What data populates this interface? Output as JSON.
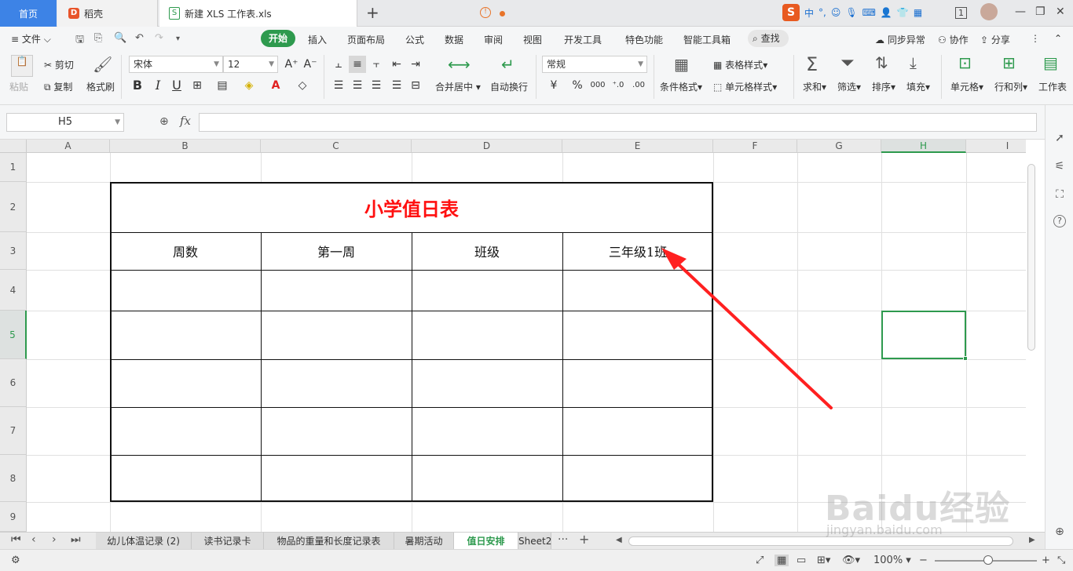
{
  "titlebar": {
    "home_tab": "首页",
    "docer_tab": "稻壳",
    "docer_logo": "D",
    "doc_tab": "新建 XLS 工作表.xls",
    "doc_icon": "S",
    "warn_icon": "!",
    "add_tab": "+",
    "ime": {
      "logo": "S",
      "mode": "中",
      "punct": "°,"
    },
    "window_count": "1"
  },
  "menubar": {
    "file": "文件",
    "items": [
      "开始",
      "插入",
      "页面布局",
      "公式",
      "数据",
      "审阅",
      "视图",
      "开发工具",
      "特色功能",
      "智能工具箱"
    ],
    "search": "查找",
    "right": [
      "同步异常",
      "协作",
      "分享"
    ]
  },
  "ribbon": {
    "paste": "粘贴",
    "cut": "剪切",
    "copy": "复制",
    "format_painter": "格式刷",
    "font_name": "宋体",
    "font_size": "12",
    "merge_center": "合并居中",
    "wrap_text": "自动换行",
    "number_format": "常规",
    "conditional_format": "条件格式",
    "table_style": "表格样式",
    "cell_style": "单元格样式",
    "sum": "求和",
    "filter": "筛选",
    "sort": "排序",
    "fill": "填充",
    "cell": "单元格",
    "row_col": "行和列",
    "worksheet": "工作表",
    "bold": "B",
    "italic": "I",
    "underline": "U"
  },
  "formula": {
    "name_box": "H5",
    "fx": "fx",
    "value": ""
  },
  "grid": {
    "columns": [
      "A",
      "B",
      "C",
      "D",
      "E",
      "F",
      "G",
      "H",
      "I"
    ],
    "rows": [
      "1",
      "2",
      "3",
      "4",
      "5",
      "6",
      "7",
      "8",
      "9"
    ],
    "selected_cell": "H5"
  },
  "table": {
    "title": "小学值日表",
    "header_row": [
      "周数",
      "第一周",
      "班级",
      "三年级1班"
    ]
  },
  "sheets": {
    "tabs": [
      "幼儿体温记录 (2)",
      "读书记录卡",
      "物品的重量和长度记录表",
      "暑期活动",
      "值日安排",
      "Sheet2"
    ],
    "active": "值日安排",
    "more": "···",
    "add": "+"
  },
  "status": {
    "zoom": "100%"
  },
  "colors": {
    "accent": "#2e9a4e",
    "title_red": "#ff1010",
    "arrow_red": "#ff2020",
    "home_tab_blue": "#3d83e6"
  },
  "watermark": {
    "brand": "Baidu经验",
    "url": "jingyan.baidu.com"
  }
}
